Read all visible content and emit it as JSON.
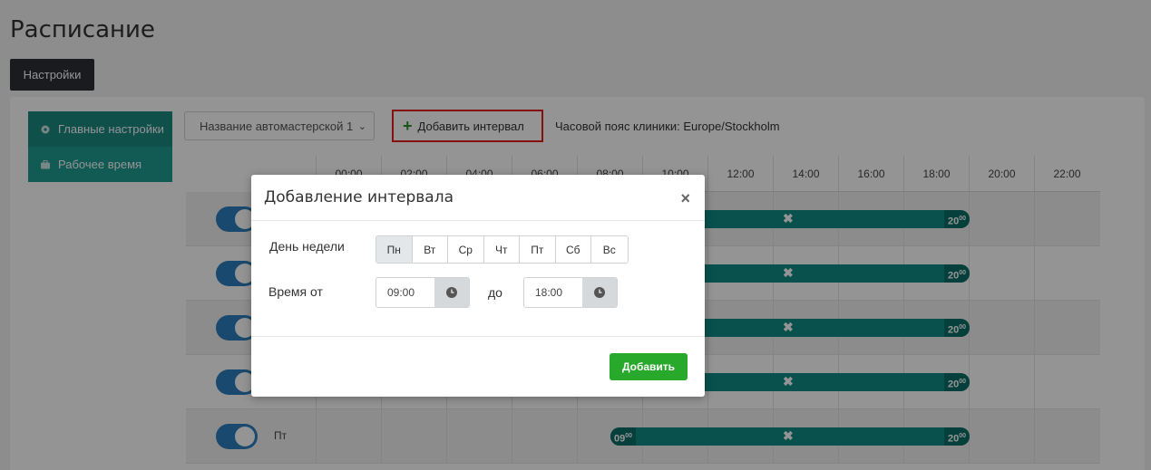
{
  "page": {
    "title": "Расписание",
    "settings_button": "Настройки"
  },
  "sidebar": {
    "items": [
      {
        "label": "Главные настройки",
        "icon": "gear-icon"
      },
      {
        "label": "Рабочее время",
        "icon": "briefcase-icon"
      }
    ]
  },
  "toolbar": {
    "clinic_select_value": "Название автомастерской 1",
    "add_interval_label": "Добавить интервал",
    "timezone_text": "Часовой пояс клиники: Europe/Stockholm"
  },
  "timeline": {
    "hours": [
      "00:00",
      "02:00",
      "04:00",
      "06:00",
      "08:00",
      "10:00",
      "12:00",
      "14:00",
      "16:00",
      "18:00",
      "20:00",
      "22:00"
    ],
    "rows": [
      {
        "day": "",
        "end_h": "20",
        "end_m": "00"
      },
      {
        "day": "",
        "end_h": "20",
        "end_m": "00"
      },
      {
        "day": "",
        "end_h": "20",
        "end_m": "00"
      },
      {
        "day": "",
        "end_h": "20",
        "end_m": "00"
      },
      {
        "day": "Пт",
        "start_h": "09",
        "start_m": "00",
        "end_h": "20",
        "end_m": "00"
      }
    ],
    "bar_delete_glyph": "✖"
  },
  "modal": {
    "title": "Добавление интервала",
    "close_glyph": "×",
    "weekday_label": "День недели",
    "weekdays": [
      "Пн",
      "Вт",
      "Ср",
      "Чт",
      "Пт",
      "Сб",
      "Вс"
    ],
    "time_from_label": "Время от",
    "time_from_value": "09:00",
    "to_label": "до",
    "time_to_value": "18:00",
    "submit_label": "Добавить"
  },
  "colors": {
    "accent_teal": "#1f9c92",
    "bar_teal": "#0e8c86",
    "toggle_blue": "#2c7fc0",
    "submit_green": "#28a92b",
    "highlight_red": "#e51c1c"
  }
}
